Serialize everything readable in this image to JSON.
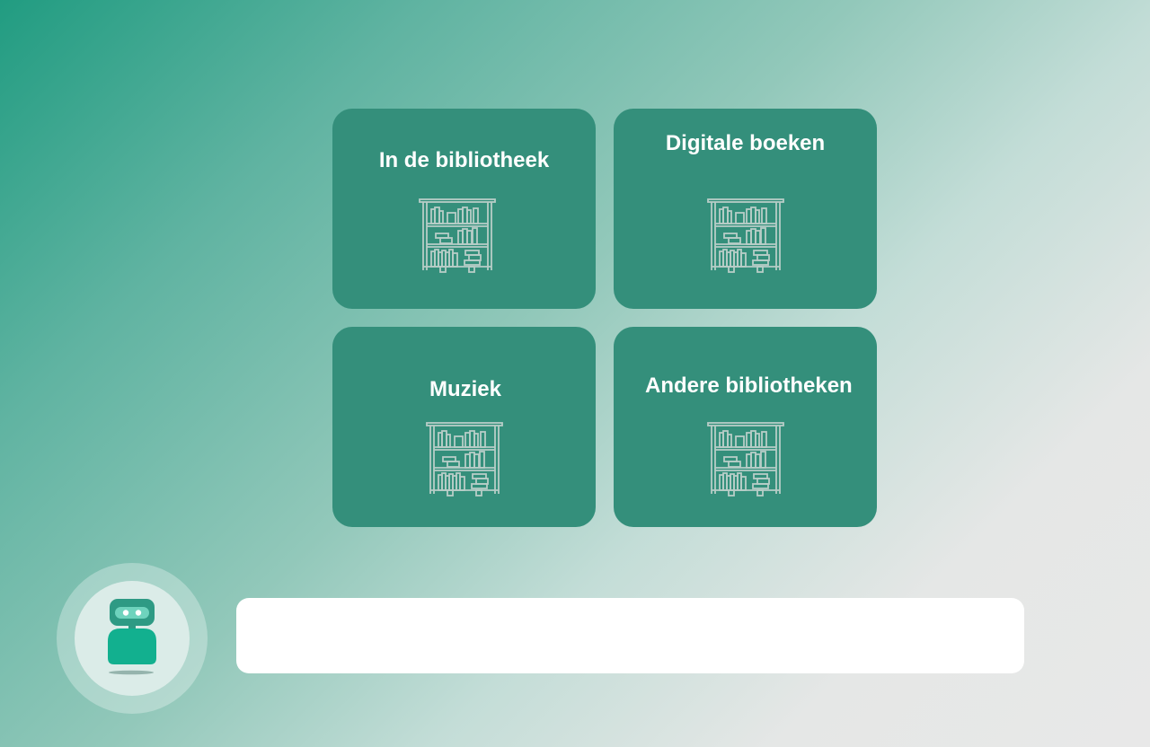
{
  "tiles": [
    {
      "label": "In de bibliotheek",
      "icon": "bookshelf-icon"
    },
    {
      "label": "Digitale boeken",
      "icon": "bookshelf-icon"
    },
    {
      "label": "Muziek",
      "icon": "bookshelf-icon"
    },
    {
      "label": "Andere bibliotheken",
      "icon": "bookshelf-icon"
    }
  ],
  "assistant": {
    "icon": "robot-icon"
  },
  "chat_input": {
    "value": "",
    "placeholder": ""
  },
  "colors": {
    "tile_background": "#348f7b",
    "tile_text": "#ffffff",
    "icon_stroke": "#b7cdc7",
    "robot_head": "#2e9a84",
    "robot_body": "#12b08f",
    "input_background": "#ffffff"
  }
}
